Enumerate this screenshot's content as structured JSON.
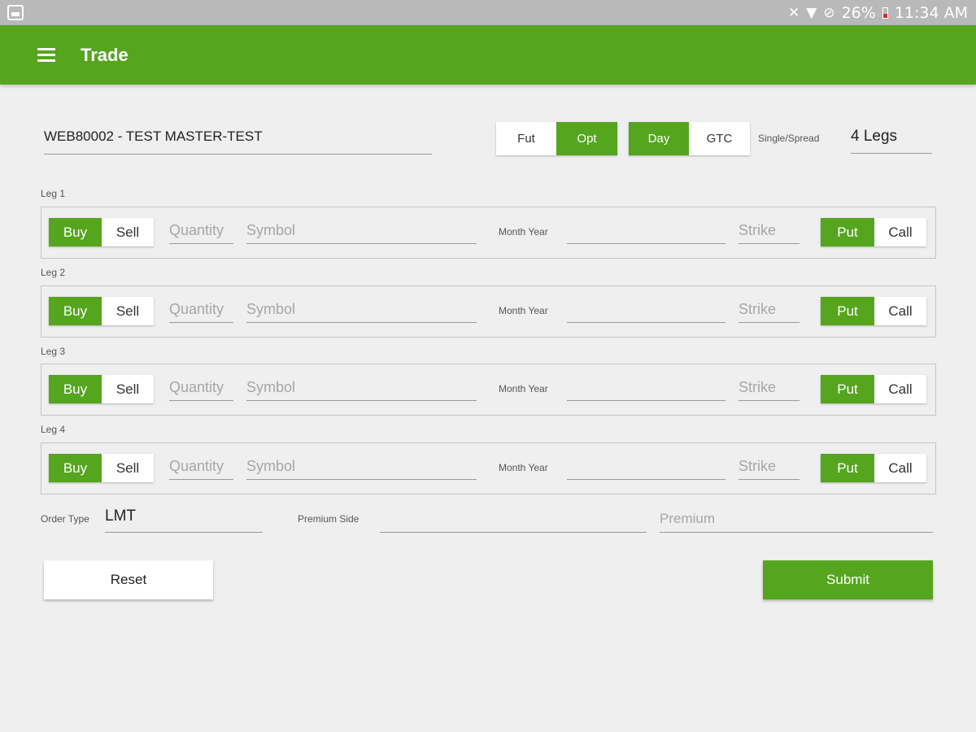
{
  "status_bar": {
    "icons": [
      "gallery-icon",
      "mute-icon",
      "wifi-icon",
      "no-disturb-icon",
      "battery-icon"
    ],
    "battery": "26%",
    "time": "11:34 AM"
  },
  "app_bar": {
    "title": "Trade",
    "menu_icon": "hamburger-menu-icon"
  },
  "account": "WEB80002 - TEST MASTER-TEST",
  "product_type": {
    "options": [
      "Fut",
      "Opt"
    ],
    "selected": "Opt"
  },
  "duration": {
    "options": [
      "Day",
      "GTC"
    ],
    "selected": "Day"
  },
  "single_spread": {
    "label": "Single/Spread",
    "value": "4 Legs"
  },
  "legs": [
    {
      "label": "Leg 1",
      "side_buy": "Buy",
      "side_sell": "Sell",
      "side_selected": "Buy",
      "quantity_placeholder": "Quantity",
      "symbol_placeholder": "Symbol",
      "month_year_label": "Month Year",
      "strike_placeholder": "Strike",
      "put": "Put",
      "call": "Call",
      "type_selected": "Put"
    },
    {
      "label": "Leg 2",
      "side_buy": "Buy",
      "side_sell": "Sell",
      "side_selected": "Buy",
      "quantity_placeholder": "Quantity",
      "symbol_placeholder": "Symbol",
      "month_year_label": "Month Year",
      "strike_placeholder": "Strike",
      "put": "Put",
      "call": "Call",
      "type_selected": "Put"
    },
    {
      "label": "Leg 3",
      "side_buy": "Buy",
      "side_sell": "Sell",
      "side_selected": "Buy",
      "quantity_placeholder": "Quantity",
      "symbol_placeholder": "Symbol",
      "month_year_label": "Month Year",
      "strike_placeholder": "Strike",
      "put": "Put",
      "call": "Call",
      "type_selected": "Put"
    },
    {
      "label": "Leg 4",
      "side_buy": "Buy",
      "side_sell": "Sell",
      "side_selected": "Buy",
      "quantity_placeholder": "Quantity",
      "symbol_placeholder": "Symbol",
      "month_year_label": "Month Year",
      "strike_placeholder": "Strike",
      "put": "Put",
      "call": "Call",
      "type_selected": "Put"
    }
  ],
  "order_type": {
    "label": "Order Type",
    "value": "LMT"
  },
  "premium_side": {
    "label": "Premium Side",
    "value": ""
  },
  "premium": {
    "placeholder": "Premium"
  },
  "buttons": {
    "reset": "Reset",
    "submit": "Submit"
  },
  "colors": {
    "accent": "#55a51e",
    "background": "#efefef",
    "status_bar": "#b9b9b9"
  }
}
